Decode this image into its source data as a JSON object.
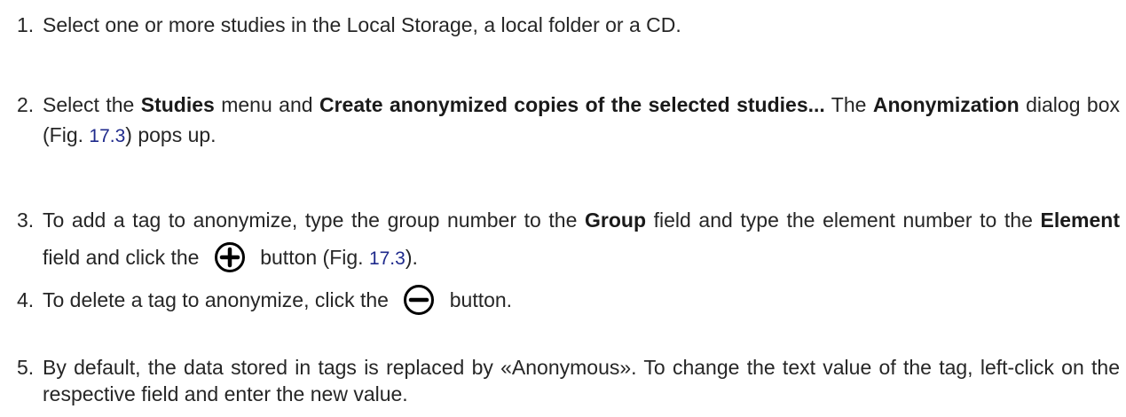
{
  "steps": [
    {
      "number": "1.",
      "text": "Select one or more studies in the Local Storage, a local folder or a CD."
    },
    {
      "number": "2.",
      "t1": "Select the ",
      "b1": "Studies",
      "t2": " menu and ",
      "b2": "Create anonymized copies of the selected studies...",
      "t3": " The ",
      "b3": "Anonymization",
      "t4": " dialog box (Fig. ",
      "fig": "17.3",
      "t5": ") pops up."
    },
    {
      "number": "3.",
      "t1": "To add a tag to anonymize, type the group number to the ",
      "b1": "Group",
      "t2": " field and type the element number to the ",
      "b2": "Element",
      "t3": " field and click the ",
      "t4": " button (Fig. ",
      "fig": "17.3",
      "t5": ").",
      "icon": "plus-circle-icon"
    },
    {
      "number": "4.",
      "t1": "To delete a tag to anonymize, click the ",
      "t2": " button.",
      "icon": "minus-circle-icon"
    },
    {
      "number": "5.",
      "text": "By default, the data stored in tags is replaced by «Anonymous». To change the text value of the tag, left-click on the respective field and enter the new value."
    }
  ],
  "colors": {
    "text": "#262626",
    "link": "#1f2a8c",
    "background": "#ffffff"
  }
}
